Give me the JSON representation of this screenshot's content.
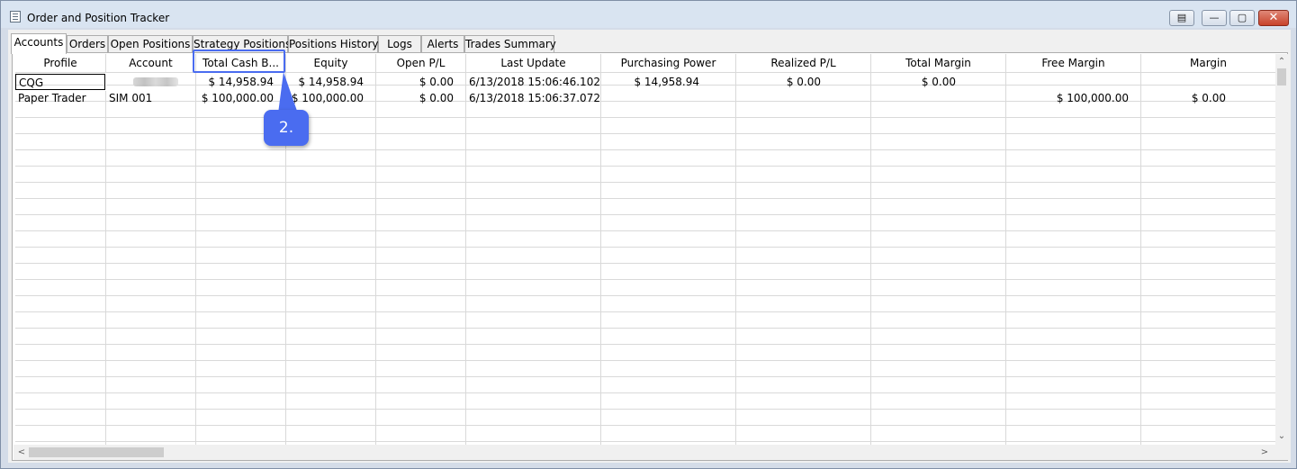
{
  "window": {
    "title": "Order and Position Tracker",
    "close_glyph": "✕",
    "min_glyph": "—",
    "max_glyph": "▢",
    "extra_glyph": "▤"
  },
  "tabs": [
    {
      "label": "Accounts",
      "active": true
    },
    {
      "label": "Orders"
    },
    {
      "label": "Open Positions"
    },
    {
      "label": "Strategy Positions"
    },
    {
      "label": "Positions History"
    },
    {
      "label": "Logs"
    },
    {
      "label": "Alerts"
    },
    {
      "label": "Trades Summary"
    }
  ],
  "table": {
    "headers": [
      "Profile",
      "Account",
      "Total Cash B...",
      "Equity",
      "Open P/L",
      "Last Update",
      "Purchasing Power",
      "Realized P/L",
      "Total Margin",
      "Free Margin",
      "Margin"
    ],
    "rows": [
      [
        "CQG",
        "",
        "$ 14,958.94",
        "$ 14,958.94",
        "$ 0.00",
        "6/13/2018 15:06:46.102",
        "$ 14,958.94",
        "$ 0.00",
        "$ 0.00",
        "",
        ""
      ],
      [
        "Paper Trader",
        "SIM 001",
        "$ 100,000.00",
        "$ 100,000.00",
        "$ 0.00",
        "6/13/2018 15:06:37.072",
        "",
        "",
        "",
        "$ 100,000.00",
        "$ 0.00"
      ]
    ]
  },
  "annotation": {
    "label": "2."
  },
  "colors": {
    "accent": "#4a6cf0",
    "grid": "#d9d9d9",
    "titlebar": "#d9e4f1"
  },
  "icons": {
    "scroll_up": "⌃",
    "scroll_down": "⌄",
    "scroll_left": "<",
    "scroll_right": ">"
  }
}
